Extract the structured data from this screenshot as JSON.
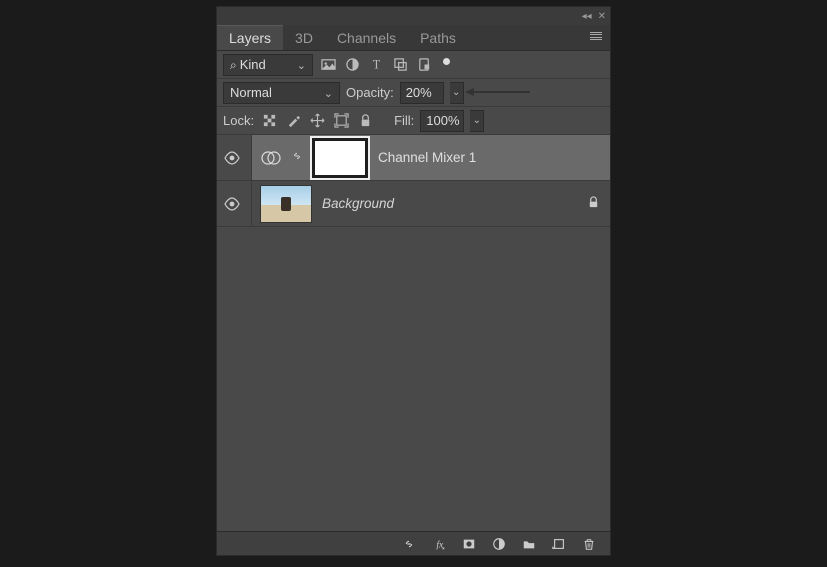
{
  "titlebar": {
    "collapse": "◂◂",
    "close": "✕"
  },
  "tabs": [
    "Layers",
    "3D",
    "Channels",
    "Paths"
  ],
  "active_tab": 0,
  "filter": {
    "label": "Kind"
  },
  "blend_mode": "Normal",
  "opacity": {
    "label": "Opacity:",
    "value": "20%"
  },
  "lock": {
    "label": "Lock:"
  },
  "fill": {
    "label": "Fill:",
    "value": "100%"
  },
  "layers": [
    {
      "name": "Channel Mixer 1",
      "type": "adjustment",
      "visible": true,
      "selected": true,
      "locked": false
    },
    {
      "name": "Background",
      "type": "image",
      "visible": true,
      "selected": false,
      "locked": true
    }
  ]
}
